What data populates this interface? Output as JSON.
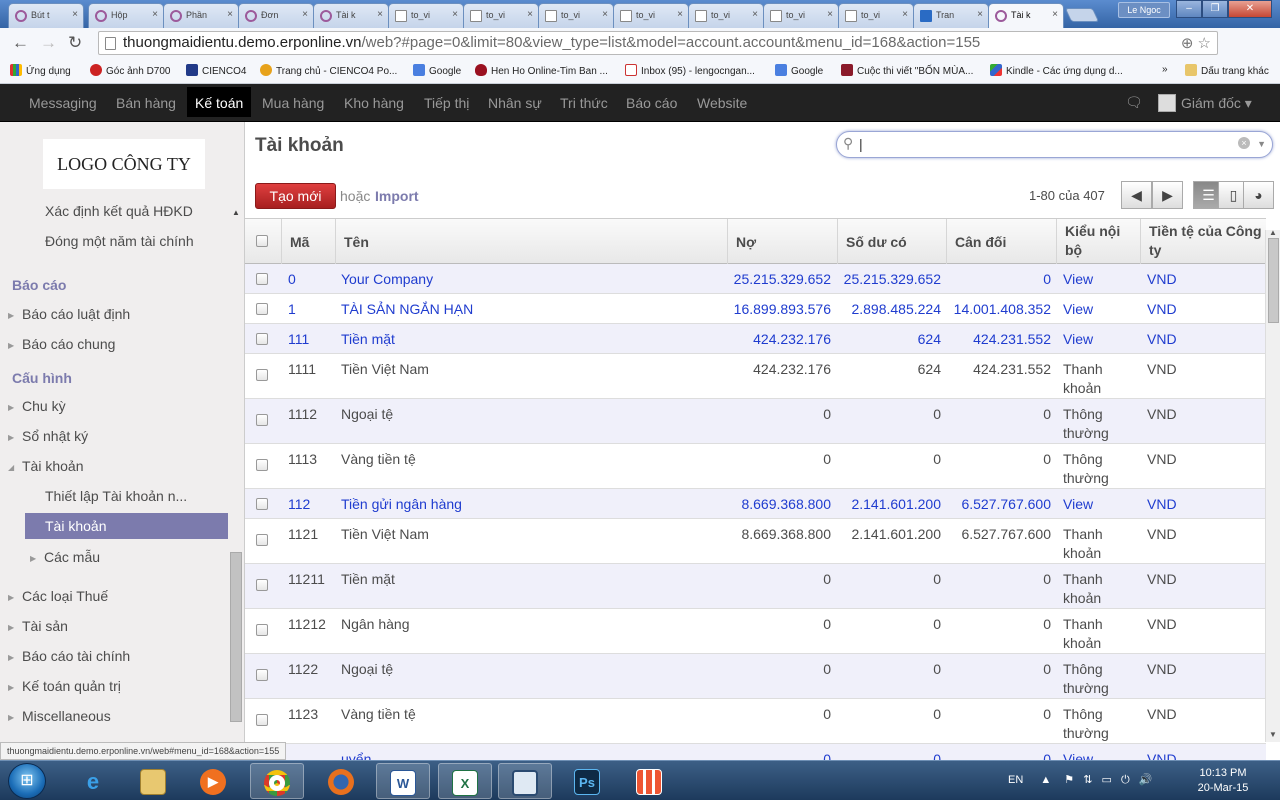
{
  "browser": {
    "tabs": [
      {
        "label": "Bút t",
        "icon": "odoo-icon"
      },
      {
        "label": "Hộp",
        "icon": "odoo-icon"
      },
      {
        "label": "Phần",
        "icon": "odoo-icon"
      },
      {
        "label": "Đơn",
        "icon": "odoo-icon"
      },
      {
        "label": "Tài k",
        "icon": "odoo-icon"
      },
      {
        "label": "to_vi",
        "icon": "document-icon"
      },
      {
        "label": "to_vi",
        "icon": "document-icon"
      },
      {
        "label": "to_vi",
        "icon": "document-icon"
      },
      {
        "label": "to_vi",
        "icon": "document-icon"
      },
      {
        "label": "to_vi",
        "icon": "document-icon"
      },
      {
        "label": "to_vi",
        "icon": "document-icon"
      },
      {
        "label": "to_vi",
        "icon": "document-icon"
      },
      {
        "label": "Tran",
        "icon": "blue-site-icon"
      },
      {
        "label": "Tài k",
        "icon": "odoo-icon",
        "active": true
      }
    ],
    "user_name": "Le Ngoc",
    "url_host": "thuongmaidientu.demo.erponline.vn",
    "url_rest": "/web?#page=0&limit=80&view_type=list&model=account.account&menu_id=168&action=155",
    "bookmarks": [
      "Ứng dụng",
      "Góc ảnh D700",
      "CIENCO4",
      "Trang chủ - CIENCO4 Po...",
      "Google",
      "Hen Ho Online-Tim Ban ...",
      "Inbox (95) - lengocngan...",
      "Google",
      "Cuộc thi viết \"BỐN MÙA...",
      "Kindle - Các ứng dụng d...",
      "»",
      "Dấu trang khác"
    ]
  },
  "topmenu": {
    "items": [
      "Messaging",
      "Bán hàng",
      "Kế toán",
      "Mua hàng",
      "Kho hàng",
      "Tiếp thị",
      "Nhân sự",
      "Tri thức",
      "Báo cáo",
      "Website"
    ],
    "active": "Kế toán",
    "user": "Giám đốc"
  },
  "sidebar": {
    "logo": "LOGO CÔNG TY",
    "items": [
      {
        "label": "Xác định kết quả HĐKD",
        "type": "sub"
      },
      {
        "label": "Đóng một năm tài chính",
        "type": "sub"
      },
      {
        "label": "Báo cáo",
        "type": "head"
      },
      {
        "label": "Báo cáo luật định",
        "type": "collapsed"
      },
      {
        "label": "Báo cáo chung",
        "type": "collapsed"
      },
      {
        "label": "Cấu hình",
        "type": "head"
      },
      {
        "label": "Chu kỳ",
        "type": "collapsed"
      },
      {
        "label": "Sổ nhật ký",
        "type": "collapsed"
      },
      {
        "label": "Tài khoản",
        "type": "expanded"
      },
      {
        "label": "Thiết lập Tài khoản n...",
        "type": "sub"
      },
      {
        "label": "Tài khoản",
        "type": "active"
      },
      {
        "label": "Các mẫu",
        "type": "subcollapsed"
      },
      {
        "label": "Các loại Thuế",
        "type": "collapsed"
      },
      {
        "label": "Tài sản",
        "type": "collapsed"
      },
      {
        "label": "Báo cáo tài chính",
        "type": "collapsed"
      },
      {
        "label": "Kế toán quản trị",
        "type": "collapsed"
      },
      {
        "label": "Miscellaneous",
        "type": "collapsed"
      }
    ]
  },
  "main": {
    "title": "Tài khoản",
    "search_value": "|",
    "create_label": "Tạo mới",
    "or_label": "hoặc",
    "import_label": "Import",
    "pager": "1-80 của 407"
  },
  "table": {
    "headers": [
      "Mã",
      "Tên",
      "Nợ",
      "Số dư có",
      "Cân đối",
      "Kiểu nội bộ",
      "Tiền tệ của Công ty"
    ],
    "rows": [
      {
        "code": "0",
        "name": "Your Company",
        "debit": "25.215.329.652",
        "credit": "25.215.329.652",
        "balance": "0",
        "type": "View",
        "currency": "VND",
        "view": true
      },
      {
        "code": "1",
        "name": "TÀI SẢN NGẮN HẠN",
        "debit": "16.899.893.576",
        "credit": "2.898.485.224",
        "balance": "14.001.408.352",
        "type": "View",
        "currency": "VND",
        "view": true
      },
      {
        "code": "111",
        "name": "Tiền mặt",
        "debit": "424.232.176",
        "credit": "624",
        "balance": "424.231.552",
        "type": "View",
        "currency": "VND",
        "view": true
      },
      {
        "code": "1111",
        "name": "Tiền Việt Nam",
        "debit": "424.232.176",
        "credit": "624",
        "balance": "424.231.552",
        "type": "Thanh khoản",
        "currency": "VND",
        "view": false
      },
      {
        "code": "1112",
        "name": "Ngoại tệ",
        "debit": "0",
        "credit": "0",
        "balance": "0",
        "type": "Thông thường",
        "currency": "VND",
        "view": false
      },
      {
        "code": "1113",
        "name": "Vàng tiền tệ",
        "debit": "0",
        "credit": "0",
        "balance": "0",
        "type": "Thông thường",
        "currency": "VND",
        "view": false
      },
      {
        "code": "112",
        "name": "Tiền gửi ngân hàng",
        "debit": "8.669.368.800",
        "credit": "2.141.601.200",
        "balance": "6.527.767.600",
        "type": "View",
        "currency": "VND",
        "view": true
      },
      {
        "code": "1121",
        "name": "Tiền Việt Nam",
        "debit": "8.669.368.800",
        "credit": "2.141.601.200",
        "balance": "6.527.767.600",
        "type": "Thanh khoản",
        "currency": "VND",
        "view": false
      },
      {
        "code": "11211",
        "name": "Tiền mặt",
        "debit": "0",
        "credit": "0",
        "balance": "0",
        "type": "Thanh khoản",
        "currency": "VND",
        "view": false
      },
      {
        "code": "11212",
        "name": "Ngân hàng",
        "debit": "0",
        "credit": "0",
        "balance": "0",
        "type": "Thanh khoản",
        "currency": "VND",
        "view": false
      },
      {
        "code": "1122",
        "name": "Ngoại tệ",
        "debit": "0",
        "credit": "0",
        "balance": "0",
        "type": "Thông thường",
        "currency": "VND",
        "view": false
      },
      {
        "code": "1123",
        "name": "Vàng tiền tệ",
        "debit": "0",
        "credit": "0",
        "balance": "0",
        "type": "Thông thường",
        "currency": "VND",
        "view": false
      },
      {
        "code": "",
        "name": "uyển",
        "debit": "0",
        "credit": "0",
        "balance": "0",
        "type": "View",
        "currency": "VND",
        "view": true
      }
    ]
  },
  "status_url": "thuongmaidientu.demo.erponline.vn/web#menu_id=168&action=155",
  "taskbar": {
    "language": "EN",
    "time": "10:13 PM",
    "date": "20-Mar-15"
  },
  "colors": {
    "accent": "#7c7bad",
    "link_blue": "#1f3ccf",
    "create_red": "#c52f2f",
    "topbar": "#222222"
  }
}
